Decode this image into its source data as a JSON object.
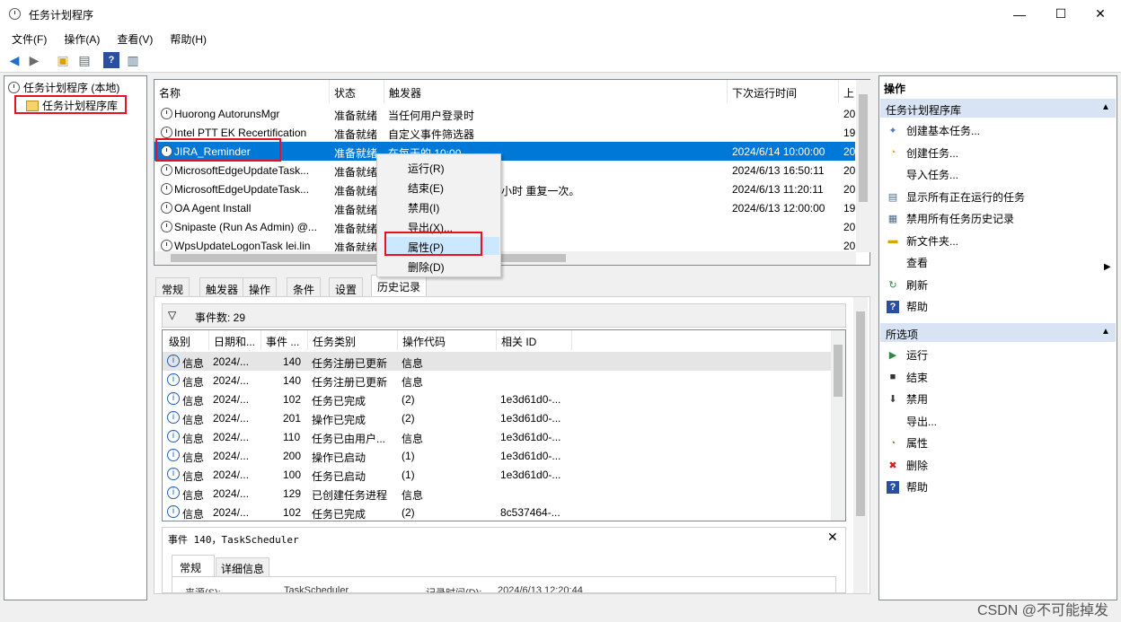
{
  "window": {
    "title": "任务计划程序",
    "minimize": "—",
    "maximize": "☐",
    "close": "✕"
  },
  "menu": [
    "文件(F)",
    "操作(A)",
    "查看(V)",
    "帮助(H)"
  ],
  "tree": {
    "root": "任务计划程序 (本地)",
    "library": "任务计划程序库"
  },
  "task_list": {
    "columns": [
      "名称",
      "状态",
      "触发器",
      "下次运行时间",
      "上"
    ],
    "rows": [
      {
        "name": "Huorong AutorunsMgr",
        "status": "准备就绪",
        "trigger": "当任何用户登录时",
        "next": "",
        "last": "20"
      },
      {
        "name": "Intel PTT EK Recertification",
        "status": "准备就绪",
        "trigger": "自定义事件筛选器",
        "next": "",
        "last": "19"
      },
      {
        "name": "JIRA_Reminder",
        "status": "准备就绪",
        "trigger": "在每天的 10:00",
        "next": "2024/6/14 10:00:00",
        "last": "20"
      },
      {
        "name": "MicrosoftEdgeUpdateTask...",
        "status": "准备就绪",
        "trigger": "",
        "next": "2024/6/13 16:50:11",
        "last": "20"
      },
      {
        "name": "MicrosoftEdgeUpdateTask...",
        "status": "准备就绪",
        "trigger": "后，在 1 天 期间每隔 1 小时 重复一次。",
        "next": "2024/6/13 11:20:11",
        "last": "20"
      },
      {
        "name": "OA Agent Install",
        "status": "准备就绪",
        "trigger": "",
        "next": "2024/6/13 12:00:00",
        "last": "19"
      },
      {
        "name": "Snipaste (Run As Admin) @...",
        "status": "准备就绪",
        "trigger": "",
        "next": "",
        "last": "20"
      },
      {
        "name": "WpsUpdateLogonTask lei.lin",
        "status": "准备就绪",
        "trigger": "",
        "next": "",
        "last": "20"
      }
    ]
  },
  "context_menu": [
    "运行(R)",
    "结束(E)",
    "禁用(I)",
    "导出(X)...",
    "属性(P)",
    "删除(D)"
  ],
  "tabs": [
    "常规",
    "触发器",
    "操作",
    "条件",
    "设置",
    "历史记录"
  ],
  "history": {
    "event_count": "事件数: 29",
    "columns": [
      "级别",
      "日期和...",
      "事件 ...",
      "任务类别",
      "操作代码",
      "相关 ID"
    ],
    "rows": [
      [
        "信息",
        "2024/...",
        "140",
        "任务注册已更新",
        "信息",
        ""
      ],
      [
        "信息",
        "2024/...",
        "140",
        "任务注册已更新",
        "信息",
        ""
      ],
      [
        "信息",
        "2024/...",
        "102",
        "任务已完成",
        "(2)",
        "1e3d61d0-..."
      ],
      [
        "信息",
        "2024/...",
        "201",
        "操作已完成",
        "(2)",
        "1e3d61d0-..."
      ],
      [
        "信息",
        "2024/...",
        "110",
        "任务已由用户...",
        "信息",
        "1e3d61d0-..."
      ],
      [
        "信息",
        "2024/...",
        "200",
        "操作已启动",
        "(1)",
        "1e3d61d0-..."
      ],
      [
        "信息",
        "2024/...",
        "100",
        "任务已启动",
        "(1)",
        "1e3d61d0-..."
      ],
      [
        "信息",
        "2024/...",
        "129",
        "已创建任务进程",
        "信息",
        ""
      ],
      [
        "信息",
        "2024/...",
        "102",
        "任务已完成",
        "(2)",
        "8c537464-..."
      ]
    ],
    "event_title": "事件 140，TaskScheduler",
    "event_tabs": [
      "常规",
      "详细信息"
    ],
    "partial": {
      "source_label": "来源(S):",
      "source": "TaskScheduler",
      "logged_label": "记录时间(D):",
      "logged": "2024/6/13 12:20:44"
    }
  },
  "actions": {
    "title": "操作",
    "section1": "任务计划程序库",
    "items1": [
      "创建基本任务...",
      "创建任务...",
      "导入任务...",
      "显示所有正在运行的任务",
      "禁用所有任务历史记录",
      "新文件夹...",
      "查看",
      "刷新",
      "帮助"
    ],
    "section2": "所选项",
    "items2": [
      "运行",
      "结束",
      "禁用",
      "导出...",
      "属性",
      "删除",
      "帮助"
    ]
  },
  "watermark": "CSDN @不可能掉发"
}
